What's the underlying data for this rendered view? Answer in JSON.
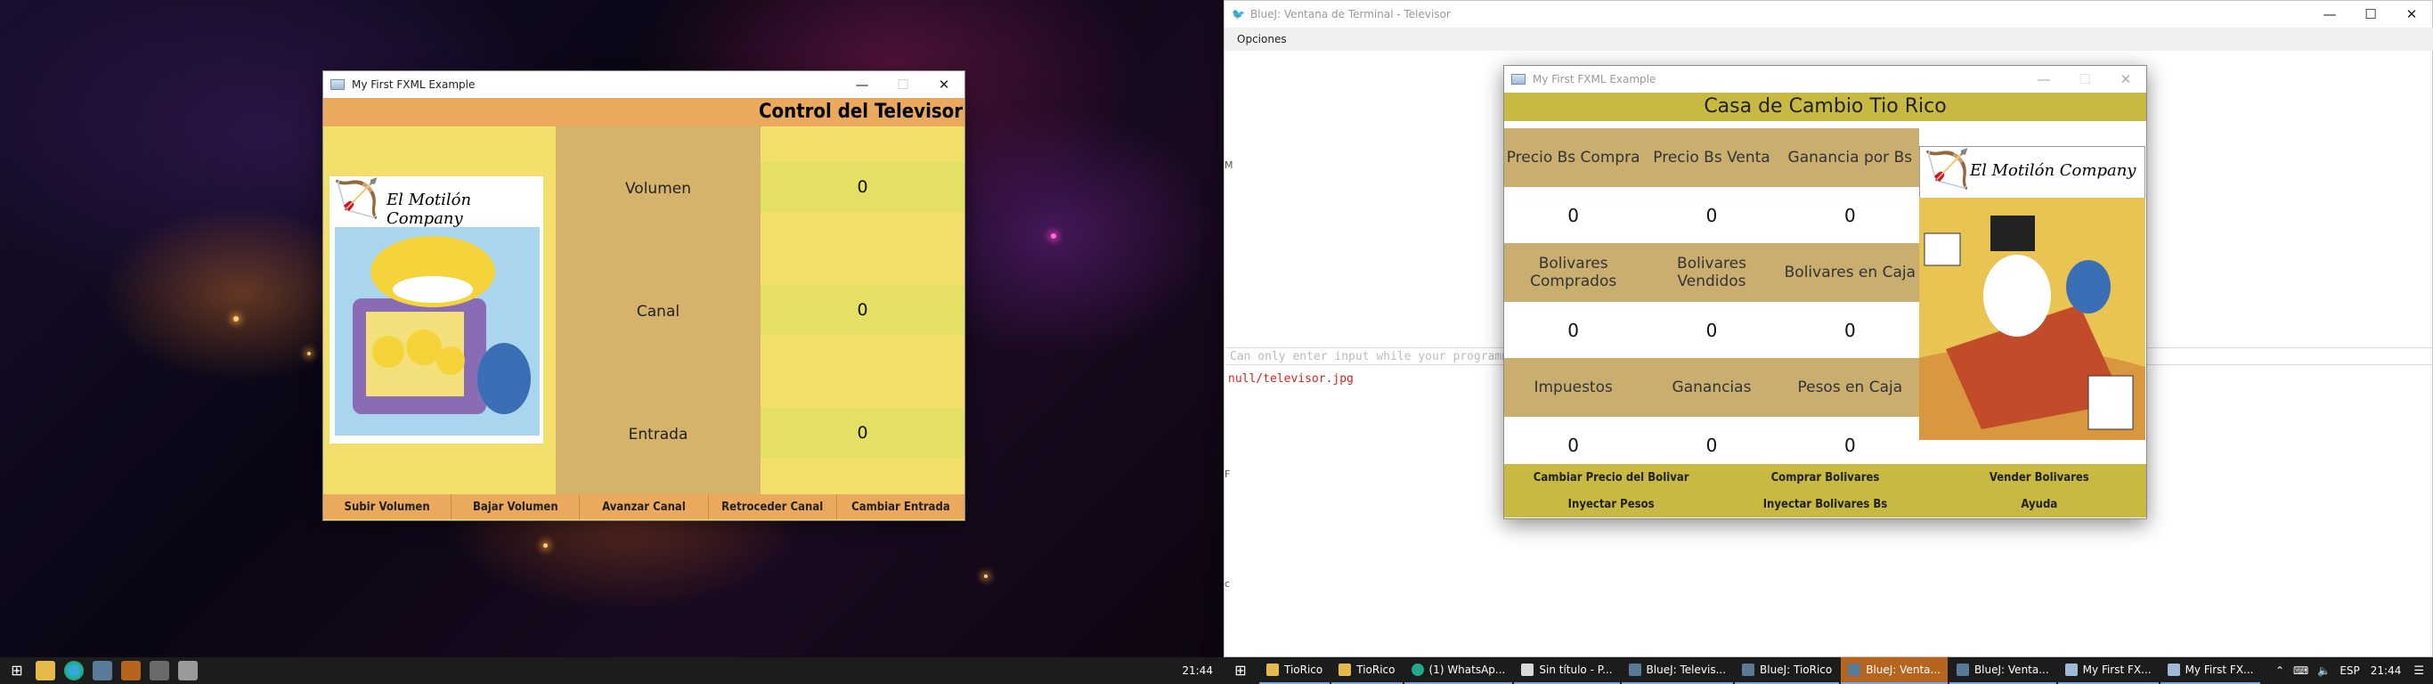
{
  "tv_window": {
    "title": "My First FXML Example",
    "header": "Control del Televisor",
    "logo_text": "El Motilón Company",
    "labels": {
      "volumen": "Volumen",
      "canal": "Canal",
      "entrada": "Entrada"
    },
    "values": {
      "volumen": "0",
      "canal": "0",
      "entrada": "0"
    },
    "buttons": [
      "Subir Volumen",
      "Bajar Volumen",
      "Avanzar Canal",
      "Retroceder Canal",
      "Cambiar Entrada"
    ]
  },
  "terminal_window": {
    "title": "BlueJ: Ventana de Terminal - Televisor",
    "menu": "Opciones",
    "input_placeholder": "Can only enter input while your programming is running",
    "output": "null/televisor.jpg"
  },
  "rico_window": {
    "title": "My First FXML Example",
    "header": "Casa de Cambio Tio Rico",
    "logo_text": "El Motilón Company",
    "row1_headers": [
      "Precio Bs Compra",
      "Precio Bs Venta",
      "Ganancia por Bs"
    ],
    "row1_values": [
      "0",
      "0",
      "0"
    ],
    "row2_headers": [
      "Bolivares Comprados",
      "Bolivares Vendidos",
      "Bolivares en Caja"
    ],
    "row2_values": [
      "0",
      "0",
      "0"
    ],
    "row3_headers": [
      "Impuestos",
      "Ganancias",
      "Pesos en Caja"
    ],
    "row3_values": [
      "0",
      "0",
      "0"
    ],
    "buttons_row1": [
      "Cambiar Precio del Bolivar",
      "Comprar Bolivares",
      "Vender Bolivares"
    ],
    "buttons_row2": [
      "Inyectar Pesos",
      "Inyectar Bolivares Bs",
      "Ayuda"
    ]
  },
  "taskbar_left": {
    "time": "21:44"
  },
  "taskbar_right": {
    "items": [
      "TioRico",
      "TioRico",
      "(1) WhatsAp...",
      "Sin título - P...",
      "BlueJ: Televis...",
      "BlueJ: TioRico",
      "BlueJ: Venta...",
      "BlueJ: Venta...",
      "My First FX...",
      "My First FX..."
    ],
    "lang": "ESP",
    "time": "21:44"
  },
  "colors": {
    "tv_header": "#eba95d",
    "tv_panel": "#f2df6c",
    "tv_mid": "#d5b36b",
    "rico_header": "#c8b942",
    "rico_label_row": "#c9ae70"
  }
}
